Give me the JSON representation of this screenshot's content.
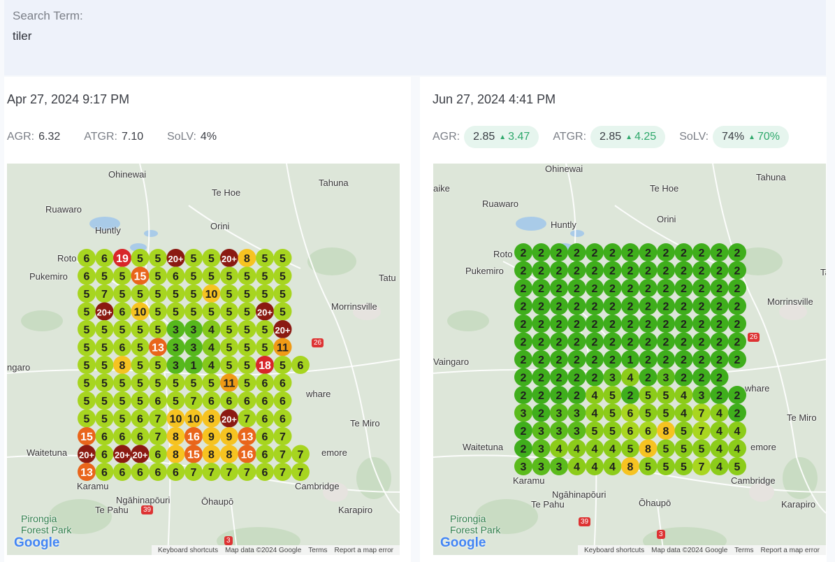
{
  "search": {
    "label": "Search Term:",
    "value": "tiler"
  },
  "left": {
    "date": "Apr 27, 2024 9:17 PM",
    "metrics": [
      {
        "label": "AGR:",
        "value": "6.32"
      },
      {
        "label": "ATGR:",
        "value": "7.10"
      },
      {
        "label": "SoLV:",
        "value": "4%"
      }
    ],
    "places": [
      "Ohinewai",
      "Te Hoe",
      "Tahuna",
      "Ruawaro",
      "Huntly",
      "Orini",
      "Roto",
      "Pukemiro",
      "Tatu",
      "Morrinsville",
      "ngaro",
      "whare",
      "Te Miro",
      "Waitetuna",
      "emore",
      "Cambridge",
      "Karamu",
      "Ngāhinapōuri",
      "Te Pahu",
      "Ōhaupō",
      "Karapiro",
      "Pirongia Forest Park",
      "26",
      "39",
      "3"
    ],
    "grid": [
      [
        "6",
        "6",
        "19",
        "5",
        "5",
        "20+",
        "5",
        "5",
        "20+",
        "8",
        "5",
        "5"
      ],
      [
        "6",
        "5",
        "5",
        "15",
        "5",
        "6",
        "5",
        "5",
        "5",
        "5",
        "5",
        "5"
      ],
      [
        "5",
        "7",
        "5",
        "5",
        "5",
        "5",
        "5",
        "10",
        "5",
        "5",
        "5",
        "5"
      ],
      [
        "5",
        "20+",
        "6",
        "10",
        "5",
        "5",
        "5",
        "5",
        "5",
        "5",
        "20+",
        "5"
      ],
      [
        "5",
        "5",
        "5",
        "5",
        "5",
        "3",
        "3",
        "4",
        "5",
        "5",
        "5",
        "20+"
      ],
      [
        "5",
        "5",
        "6",
        "5",
        "13",
        "3",
        "3",
        "4",
        "5",
        "5",
        "5",
        "11"
      ],
      [
        "5",
        "5",
        "8",
        "5",
        "5",
        "3",
        "1",
        "4",
        "5",
        "5",
        "18",
        "5",
        "6"
      ],
      [
        "5",
        "5",
        "5",
        "5",
        "5",
        "5",
        "5",
        "5",
        "11",
        "5",
        "6",
        "6"
      ],
      [
        "5",
        "5",
        "5",
        "5",
        "6",
        "5",
        "7",
        "6",
        "6",
        "6",
        "6",
        "6"
      ],
      [
        "5",
        "5",
        "5",
        "6",
        "7",
        "10",
        "10",
        "8",
        "20+",
        "7",
        "6",
        "6"
      ],
      [
        "15",
        "6",
        "6",
        "6",
        "7",
        "8",
        "16",
        "9",
        "9",
        "13",
        "6",
        "7"
      ],
      [
        "20+",
        "6",
        "20+",
        "20+",
        "6",
        "8",
        "15",
        "8",
        "8",
        "16",
        "6",
        "7",
        "7"
      ],
      [
        "13",
        "6",
        "6",
        "6",
        "6",
        "6",
        "7",
        "7",
        "7",
        "7",
        "6",
        "7",
        "7"
      ]
    ],
    "footer": [
      "Keyboard shortcuts",
      "Map data ©2024 Google",
      "Terms",
      "Report a map error"
    ],
    "google": "Google"
  },
  "right": {
    "date": "Jun 27, 2024 4:41 PM",
    "metrics": [
      {
        "label": "AGR:",
        "value": "2.85",
        "change": "3.47"
      },
      {
        "label": "ATGR:",
        "value": "2.85",
        "change": "4.25"
      },
      {
        "label": "SoLV:",
        "value": "74%",
        "change": "70%"
      }
    ],
    "places": [
      "Ohinewai",
      "Te Hoe",
      "Tahuna",
      "aike",
      "Ruawaro",
      "Huntly",
      "Orini",
      "Roto",
      "Pukemiro",
      "Ta",
      "Morrinsville",
      "Vaingaro",
      "whare",
      "Te Miro",
      "Waitetuna",
      "emore",
      "Cambridge",
      "Karamu",
      "Ngāhinapōuri",
      "Te Pahu",
      "Ōhaupō",
      "Karapiro",
      "Pirongia Forest Park",
      "26",
      "39",
      "3"
    ],
    "grid": [
      [
        "2",
        "2",
        "2",
        "2",
        "2",
        "2",
        "2",
        "2",
        "2",
        "2",
        "2",
        "2",
        "2"
      ],
      [
        "2",
        "2",
        "2",
        "2",
        "2",
        "2",
        "2",
        "2",
        "2",
        "2",
        "2",
        "2",
        "2"
      ],
      [
        "2",
        "2",
        "2",
        "2",
        "2",
        "2",
        "2",
        "2",
        "2",
        "2",
        "2",
        "2",
        "2"
      ],
      [
        "2",
        "2",
        "2",
        "2",
        "2",
        "2",
        "2",
        "2",
        "2",
        "2",
        "2",
        "2",
        "2"
      ],
      [
        "2",
        "2",
        "2",
        "2",
        "2",
        "2",
        "2",
        "2",
        "2",
        "2",
        "2",
        "2",
        "2"
      ],
      [
        "2",
        "2",
        "2",
        "2",
        "2",
        "2",
        "2",
        "2",
        "2",
        "2",
        "2",
        "2",
        "2"
      ],
      [
        "2",
        "2",
        "2",
        "2",
        "2",
        "2",
        "1",
        "2",
        "2",
        "2",
        "2",
        "2",
        "2"
      ],
      [
        "2",
        "2",
        "2",
        "2",
        "2",
        "3",
        "4",
        "2",
        "3",
        "2",
        "2",
        "2"
      ],
      [
        "2",
        "2",
        "2",
        "2",
        "4",
        "5",
        "2",
        "5",
        "5",
        "4",
        "3",
        "2",
        "2"
      ],
      [
        "3",
        "2",
        "3",
        "3",
        "4",
        "5",
        "6",
        "5",
        "5",
        "4",
        "7",
        "4",
        "2"
      ],
      [
        "2",
        "3",
        "3",
        "3",
        "5",
        "5",
        "6",
        "6",
        "8",
        "5",
        "7",
        "4",
        "4"
      ],
      [
        "2",
        "3",
        "4",
        "4",
        "4",
        "4",
        "5",
        "8",
        "5",
        "5",
        "5",
        "4",
        "4"
      ],
      [
        "3",
        "3",
        "3",
        "4",
        "4",
        "4",
        "8",
        "5",
        "5",
        "5",
        "7",
        "4",
        "5"
      ]
    ],
    "footer": [
      "Keyboard shortcuts",
      "Map data ©2024 Google",
      "Terms",
      "Report a map error"
    ],
    "google": "Google"
  }
}
